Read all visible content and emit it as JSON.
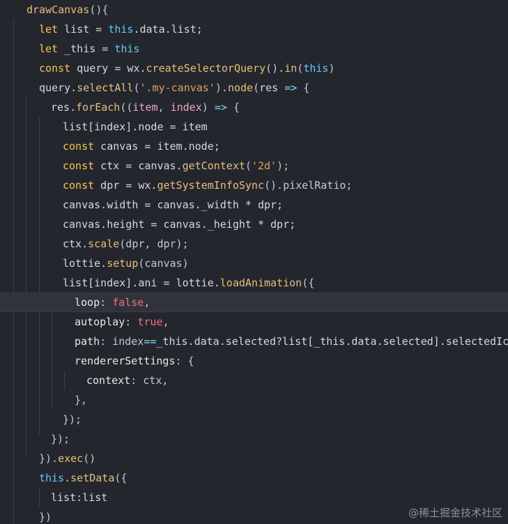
{
  "editor": {
    "lines": [
      [
        [
          "fn",
          "drawCanvas"
        ],
        [
          "punc",
          "(){"
        ]
      ],
      [
        [
          "kw",
          "let"
        ],
        [
          "plain",
          " list = "
        ],
        [
          "this",
          "this"
        ],
        [
          "plain",
          ".data.list;"
        ]
      ],
      [
        [
          "kw",
          "let"
        ],
        [
          "plain",
          " _this = "
        ],
        [
          "this",
          "this"
        ]
      ],
      [
        [
          "kw",
          "const"
        ],
        [
          "plain",
          " query = wx."
        ],
        [
          "call",
          "createSelectorQuery"
        ],
        [
          "punc",
          "()."
        ],
        [
          "call",
          "in"
        ],
        [
          "punc",
          "("
        ],
        [
          "this",
          "this"
        ],
        [
          "punc",
          ")"
        ]
      ],
      [
        [
          "plain",
          "query."
        ],
        [
          "call",
          "selectAll"
        ],
        [
          "punc",
          "("
        ],
        [
          "str",
          "'.my-canvas'"
        ],
        [
          "punc",
          ")."
        ],
        [
          "call",
          "node"
        ],
        [
          "punc",
          "("
        ],
        [
          "plain",
          "res "
        ],
        [
          "op",
          "=>"
        ],
        [
          "punc",
          " {"
        ]
      ],
      [
        [
          "plain",
          "res."
        ],
        [
          "call",
          "forEach"
        ],
        [
          "punc",
          "(("
        ],
        [
          "param",
          "item"
        ],
        [
          "punc",
          ", "
        ],
        [
          "param",
          "index"
        ],
        [
          "punc",
          ") "
        ],
        [
          "op",
          "=>"
        ],
        [
          "punc",
          " {"
        ]
      ],
      [
        [
          "plain",
          "list[index].node = item"
        ]
      ],
      [
        [
          "kw",
          "const"
        ],
        [
          "plain",
          " canvas = item.node;"
        ]
      ],
      [
        [
          "kw",
          "const"
        ],
        [
          "plain",
          " ctx = canvas."
        ],
        [
          "call",
          "getContext"
        ],
        [
          "punc",
          "("
        ],
        [
          "str",
          "'2d'"
        ],
        [
          "punc",
          ");"
        ]
      ],
      [
        [
          "kw",
          "const"
        ],
        [
          "plain",
          " dpr = wx."
        ],
        [
          "call",
          "getSystemInfoSync"
        ],
        [
          "punc",
          "().pixelRatio;"
        ]
      ],
      [
        [
          "plain",
          "canvas.width = canvas._width * dpr;"
        ]
      ],
      [
        [
          "plain",
          "canvas.height = canvas._height * dpr;"
        ]
      ],
      [
        [
          "plain",
          "ctx."
        ],
        [
          "call",
          "scale"
        ],
        [
          "punc",
          "(dpr, dpr);"
        ]
      ],
      [
        [
          "plain",
          "lottie."
        ],
        [
          "call",
          "setup"
        ],
        [
          "punc",
          "(canvas)"
        ]
      ],
      [
        [
          "plain",
          "list[index].ani = lottie."
        ],
        [
          "call",
          "loadAnimation"
        ],
        [
          "punc",
          "({"
        ]
      ],
      [
        [
          "prop",
          "loop"
        ],
        [
          "punc",
          ": "
        ],
        [
          "bool",
          "false"
        ],
        [
          "punc",
          ","
        ]
      ],
      [
        [
          "prop",
          "autoplay"
        ],
        [
          "punc",
          ": "
        ],
        [
          "bool",
          "true"
        ],
        [
          "punc",
          ","
        ]
      ],
      [
        [
          "prop",
          "path"
        ],
        [
          "punc",
          ": index"
        ],
        [
          "op",
          "=="
        ],
        [
          "plain",
          "_this.data.selected?list[_this.data.selected].selectedIconP"
        ]
      ],
      [
        [
          "prop",
          "rendererSettings"
        ],
        [
          "punc",
          ": {"
        ]
      ],
      [
        [
          "prop",
          "context"
        ],
        [
          "punc",
          ": ctx,"
        ]
      ],
      [
        [
          "punc",
          "},"
        ]
      ],
      [
        [
          "punc",
          "});"
        ]
      ],
      [
        [
          "punc",
          "});"
        ]
      ],
      [
        [
          "punc",
          "})."
        ],
        [
          "call",
          "exec"
        ],
        [
          "punc",
          "()"
        ]
      ],
      [
        [
          "this",
          "this"
        ],
        [
          "punc",
          "."
        ],
        [
          "call",
          "setData"
        ],
        [
          "punc",
          "({"
        ]
      ],
      [
        [
          "plain",
          "list:list"
        ]
      ],
      [
        [
          "punc",
          "})"
        ]
      ]
    ]
  },
  "watermark": "@稀土掘金技术社区"
}
